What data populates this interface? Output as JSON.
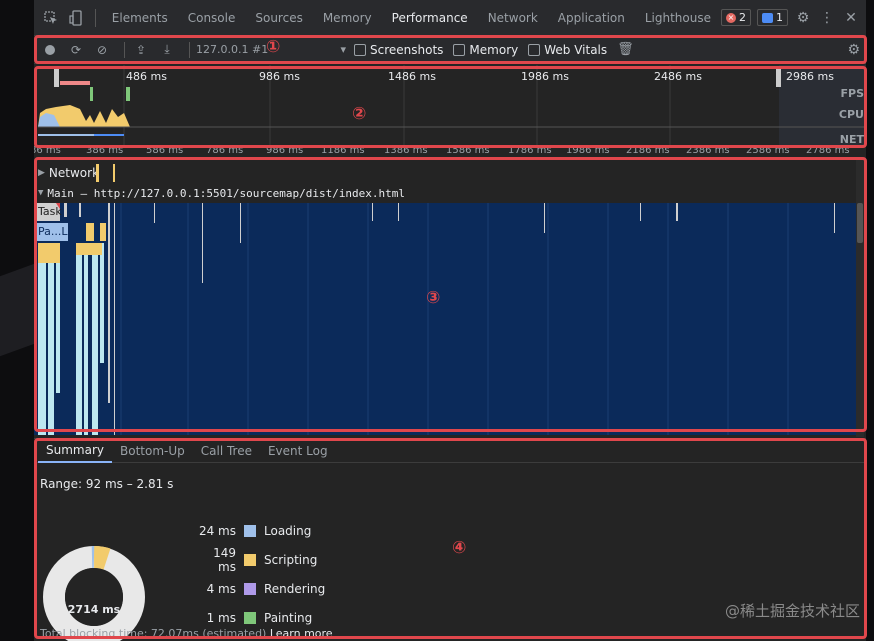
{
  "tabbar": {
    "tabs": [
      "Elements",
      "Console",
      "Sources",
      "Memory",
      "Performance",
      "Network",
      "Application",
      "Lighthouse"
    ],
    "active_tab": "Performance",
    "error_count": "2",
    "message_count": "1"
  },
  "toolbar": {
    "profile_select": "127.0.0.1 #1",
    "screenshots_label": "Screenshots",
    "memory_label": "Memory",
    "web_vitals_label": "Web Vitals"
  },
  "overview": {
    "tick_labels": [
      "486 ms",
      "986 ms",
      "1486 ms",
      "1986 ms",
      "2486 ms",
      "2986 ms"
    ],
    "fps_label": "FPS",
    "cpu_label": "CPU",
    "net_label": "NET"
  },
  "ruler": {
    "tick_labels": [
      "86 ms",
      "386 ms",
      "586 ms",
      "786 ms",
      "986 ms",
      "1186 ms",
      "1386 ms",
      "1586 ms",
      "1786 ms",
      "1986 ms",
      "2186 ms",
      "2386 ms",
      "2586 ms",
      "2786 ms"
    ]
  },
  "flame": {
    "network_track": "Network",
    "main_track": "Main — http://127.0.0.1:5501/sourcemap/dist/index.html",
    "task_label": "Task",
    "parse_label": "Pa...L"
  },
  "bottom": {
    "tabs": [
      "Summary",
      "Bottom-Up",
      "Call Tree",
      "Event Log"
    ],
    "active_tab": "Summary",
    "range": "Range: 92 ms – 2.81 s",
    "legend": [
      {
        "ms": "24 ms",
        "name": "Loading",
        "color": "#9fc0ea"
      },
      {
        "ms": "149 ms",
        "name": "Scripting",
        "color": "#f2cb6c"
      },
      {
        "ms": "4 ms",
        "name": "Rendering",
        "color": "#af9ae9"
      },
      {
        "ms": "1 ms",
        "name": "Painting",
        "color": "#7fc77a"
      }
    ],
    "total": "2714 ms",
    "blocking_text": "Total blocking time: 72.07ms (estimated)",
    "learn_more": "Learn more"
  },
  "annotations": [
    "①",
    "②",
    "③",
    "④"
  ],
  "watermark": "@稀土掘金技术社区"
}
